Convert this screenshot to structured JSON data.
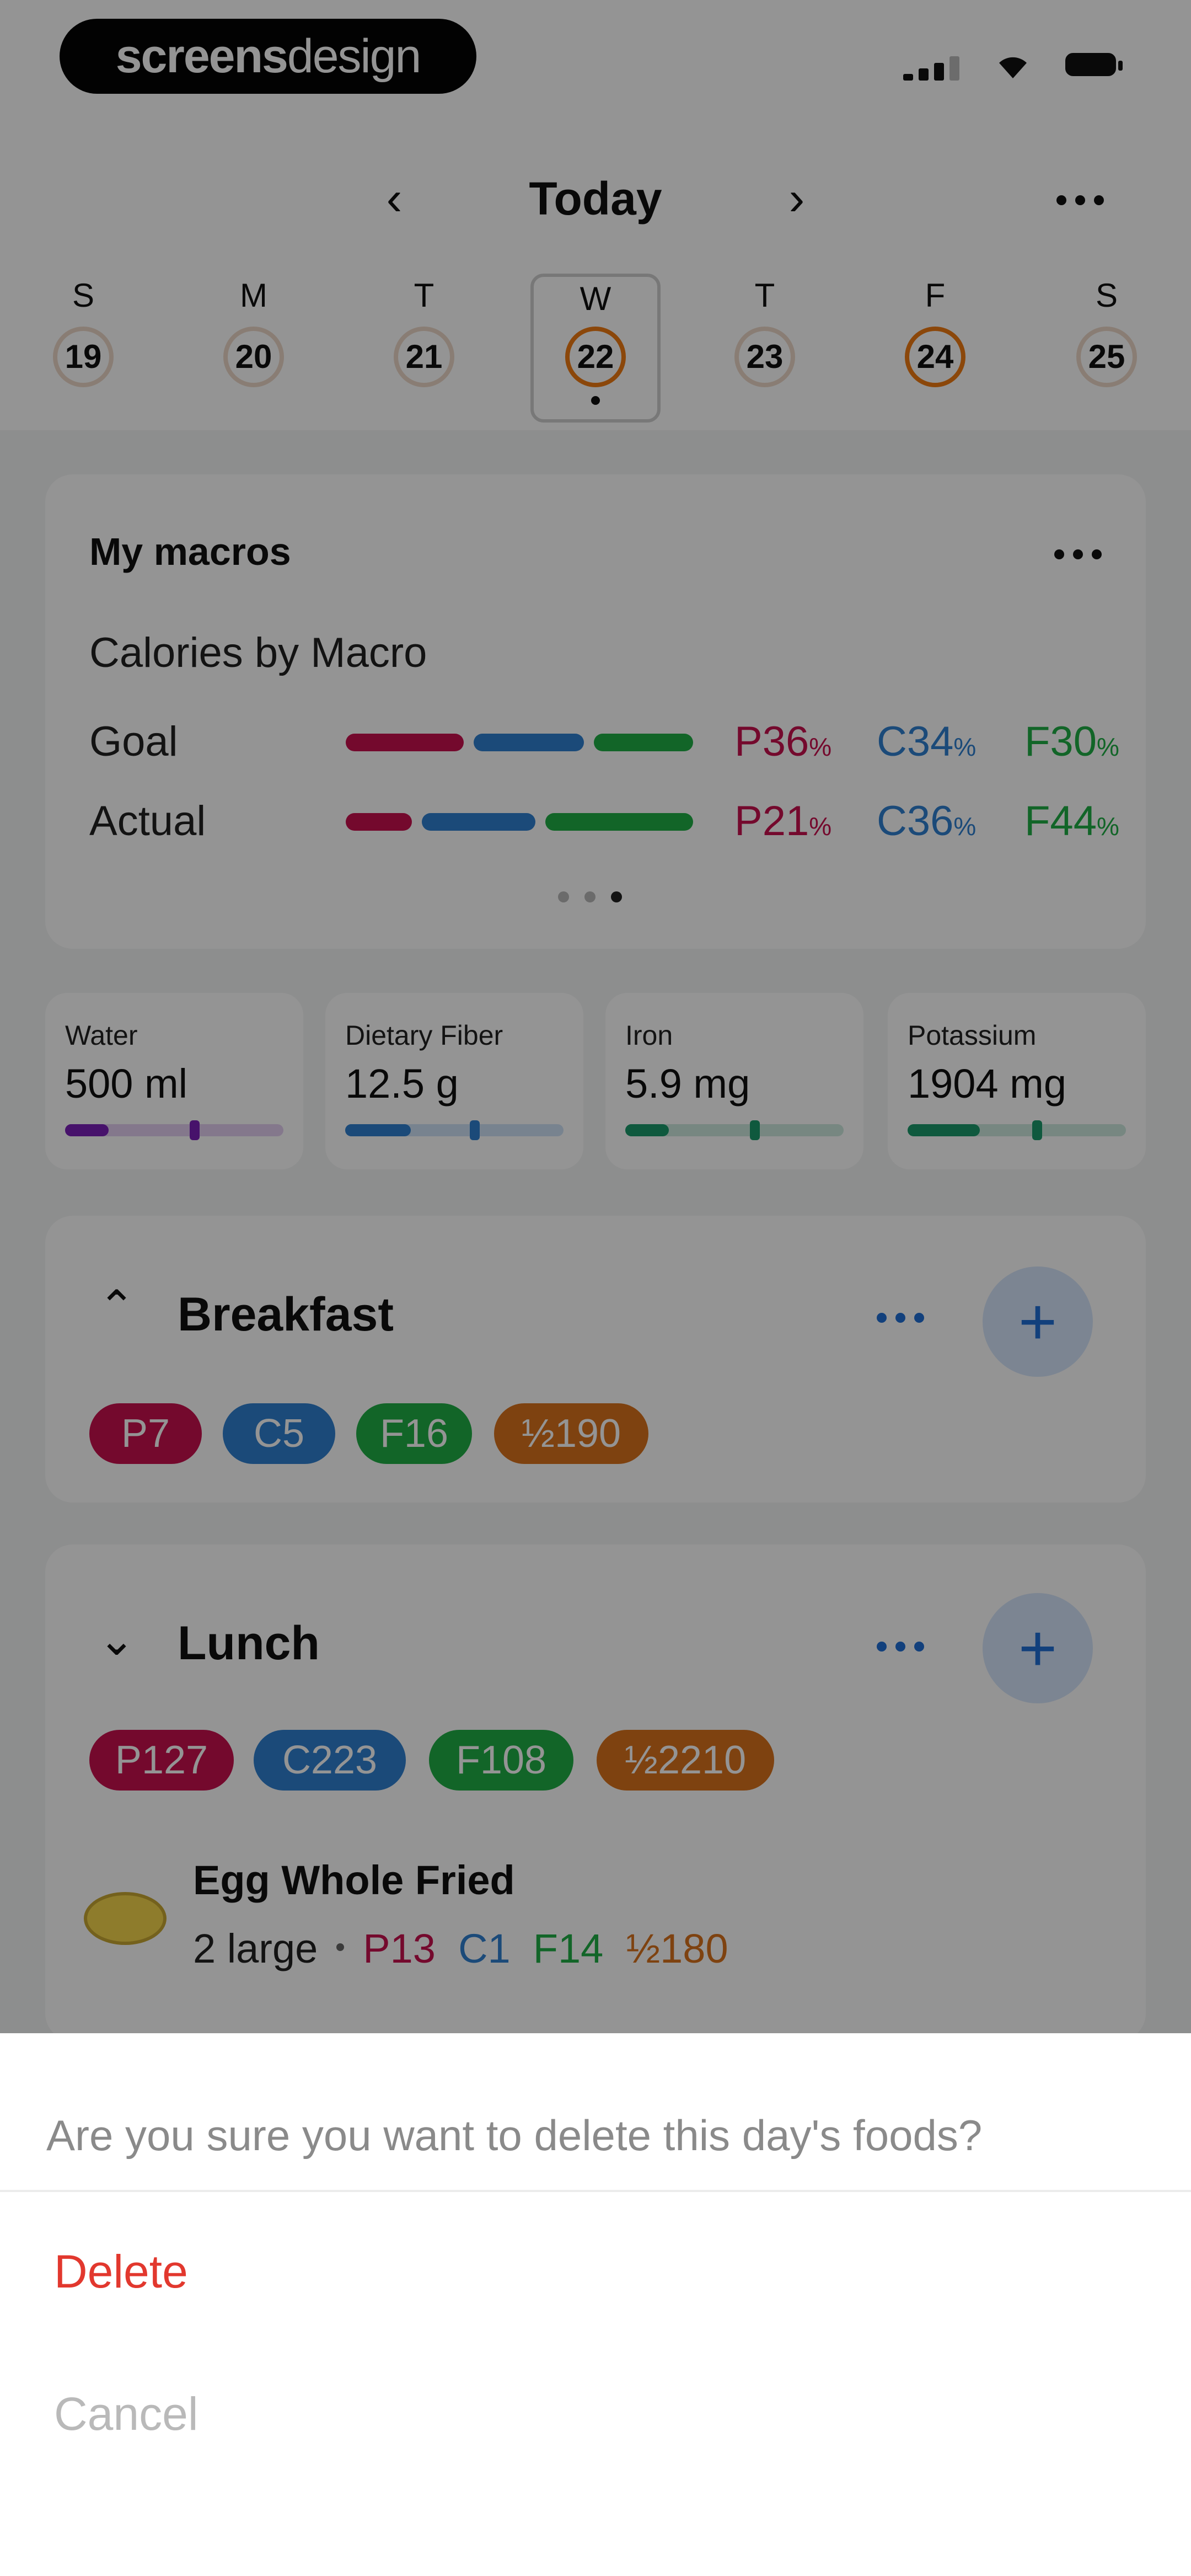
{
  "watermark": {
    "bold": "screens",
    "light": "design"
  },
  "status_bar": {
    "signal_icon": "signal-icon",
    "wifi_icon": "wifi-icon",
    "battery_icon": "battery-icon"
  },
  "nav": {
    "prev_icon": "chevron-left-icon",
    "title": "Today",
    "next_icon": "chevron-right-icon",
    "more_icon": "more-horizontal-icon"
  },
  "week": [
    {
      "letter": "S",
      "date": "19",
      "ring": false,
      "selected": false
    },
    {
      "letter": "M",
      "date": "20",
      "ring": false,
      "selected": false
    },
    {
      "letter": "T",
      "date": "21",
      "ring": false,
      "selected": false
    },
    {
      "letter": "W",
      "date": "22",
      "ring": true,
      "selected": true
    },
    {
      "letter": "T",
      "date": "23",
      "ring": false,
      "selected": false
    },
    {
      "letter": "F",
      "date": "24",
      "ring": true,
      "selected": false
    },
    {
      "letter": "S",
      "date": "25",
      "ring": false,
      "selected": false
    }
  ],
  "macros": {
    "title": "My macros",
    "subtitle": "Calories by Macro",
    "colors": {
      "protein": "#c8114f",
      "carbs": "#2f80d1",
      "fat": "#1fae45"
    },
    "rows": [
      {
        "label": "Goal",
        "p": "P36",
        "c": "C34",
        "f": "F30",
        "unit": "%",
        "share": [
          0.36,
          0.34,
          0.3
        ]
      },
      {
        "label": "Actual",
        "p": "P21",
        "c": "C36",
        "f": "F44",
        "unit": "%",
        "share": [
          0.21,
          0.36,
          0.44
        ]
      }
    ],
    "pager": {
      "count": 3,
      "active": 2
    }
  },
  "nutrients": [
    {
      "label": "Water",
      "value": "500 ml",
      "color": "#7a1fb8",
      "progress": 0.2
    },
    {
      "label": "Dietary Fiber",
      "value": "12.5 g",
      "color": "#2f80d1",
      "progress": 0.3
    },
    {
      "label": "Iron",
      "value": "5.9 mg",
      "color": "#1a9a6b",
      "progress": 0.2
    },
    {
      "label": "Potassium",
      "value": "1904 mg",
      "color": "#1a9a6b",
      "progress": 0.33
    }
  ],
  "meals": {
    "breakfast": {
      "title": "Breakfast",
      "chevron_icon": "chevron-up-icon",
      "more_icon": "more-horizontal-icon",
      "add_icon": "plus-icon",
      "add_label": "+",
      "pills": [
        {
          "text": "P7",
          "color": "#c8114f"
        },
        {
          "text": "C5",
          "color": "#2f80d1"
        },
        {
          "text": "F16",
          "color": "#1fae45"
        },
        {
          "text": "½190",
          "color": "#d9731d"
        }
      ]
    },
    "lunch": {
      "title": "Lunch",
      "chevron_icon": "chevron-down-icon",
      "more_icon": "more-horizontal-icon",
      "add_icon": "plus-icon",
      "add_label": "+",
      "pills": [
        {
          "text": "P127",
          "color": "#c8114f"
        },
        {
          "text": "C223",
          "color": "#2f80d1"
        },
        {
          "text": "F108",
          "color": "#1fae45"
        },
        {
          "text": "½2210",
          "color": "#d9731d"
        }
      ],
      "food": {
        "icon": "fried-egg-icon",
        "name": "Egg Whole Fried",
        "amount": "2 large",
        "p": "P13",
        "c": "C1",
        "f": "F14",
        "kcal": "½180"
      }
    }
  },
  "sheet": {
    "message": "Are you sure you want to delete this day's foods?",
    "delete": "Delete",
    "cancel": "Cancel",
    "delete_color": "#e2382e"
  }
}
